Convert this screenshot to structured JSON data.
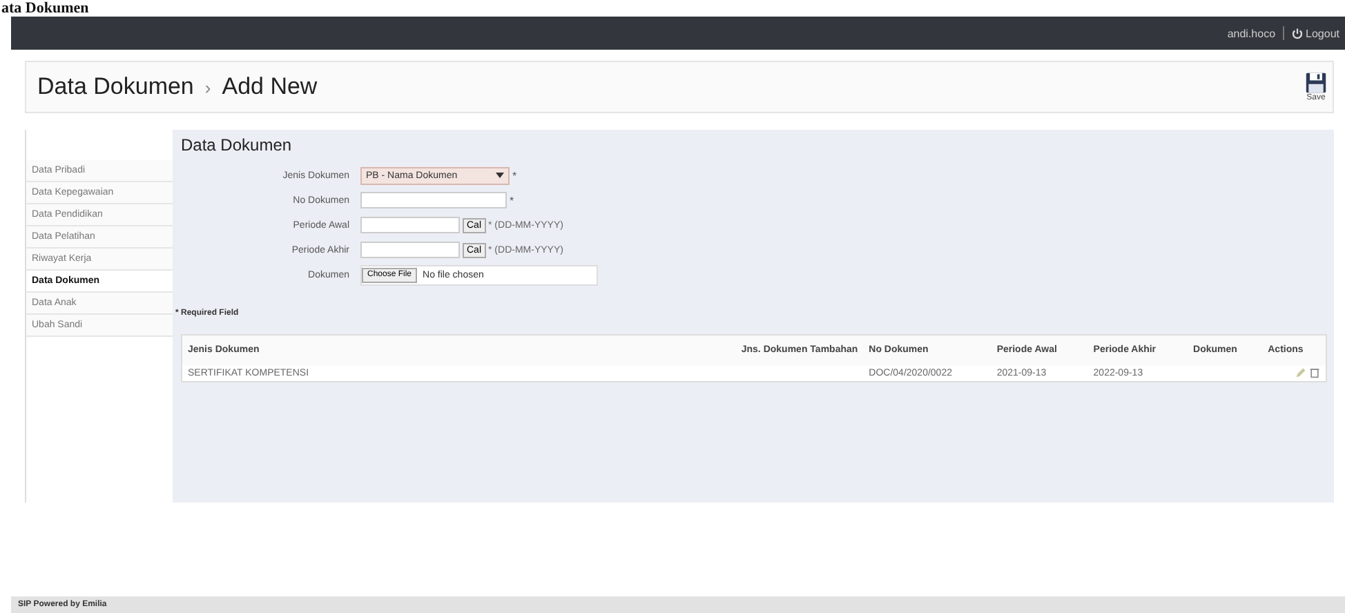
{
  "page_title": "ata Dokumen",
  "top_bar": {
    "user": "andi.hoco",
    "logout": "Logout"
  },
  "header": {
    "breadcrumb": [
      {
        "label": "Data Dokumen"
      },
      {
        "label": "Add New"
      }
    ],
    "separator": "›",
    "save_label": "Save"
  },
  "sidebar": {
    "items": [
      {
        "label": "Data Pribadi",
        "selected": false
      },
      {
        "label": "Data Kepegawaian",
        "selected": false
      },
      {
        "label": "Data Pendidikan",
        "selected": false
      },
      {
        "label": "Data Pelatihan",
        "selected": false
      },
      {
        "label": "Riwayat Kerja",
        "selected": false
      },
      {
        "label": "Data Dokumen",
        "selected": true
      },
      {
        "label": "Data Anak",
        "selected": false
      },
      {
        "label": "Ubah Sandi",
        "selected": false
      }
    ]
  },
  "form": {
    "title": "Data Dokumen",
    "fields": [
      {
        "kind": "select",
        "label": "Jenis Dokumen",
        "value": "PB - Nama Dokumen",
        "required_mark": "*"
      },
      {
        "kind": "text",
        "label": "No Dokumen",
        "required_mark": "*"
      },
      {
        "kind": "date",
        "label": "Periode Awal",
        "button": "Cal",
        "hint": "* (DD-MM-YYYY)"
      },
      {
        "kind": "date",
        "label": "Periode Akhir",
        "button": "Cal",
        "hint": "* (DD-MM-YYYY)"
      },
      {
        "kind": "file",
        "label": "Dokumen",
        "button": "Choose File",
        "value": "No file chosen"
      }
    ],
    "required_note": "* Required Field"
  },
  "table": {
    "columns": [
      "Jenis Dokumen",
      "Jns. Dokumen Tambahan",
      "No Dokumen",
      "Periode Awal",
      "Periode Akhir",
      "Dokumen",
      "Actions"
    ],
    "rows": [
      {
        "cells": [
          "SERTIFIKAT KOMPETENSI",
          "",
          "DOC/04/2020/0022",
          "2021-09-13",
          "2022-09-13",
          ""
        ]
      }
    ]
  },
  "footer": {
    "text": "SIP Powered by Emilia"
  }
}
